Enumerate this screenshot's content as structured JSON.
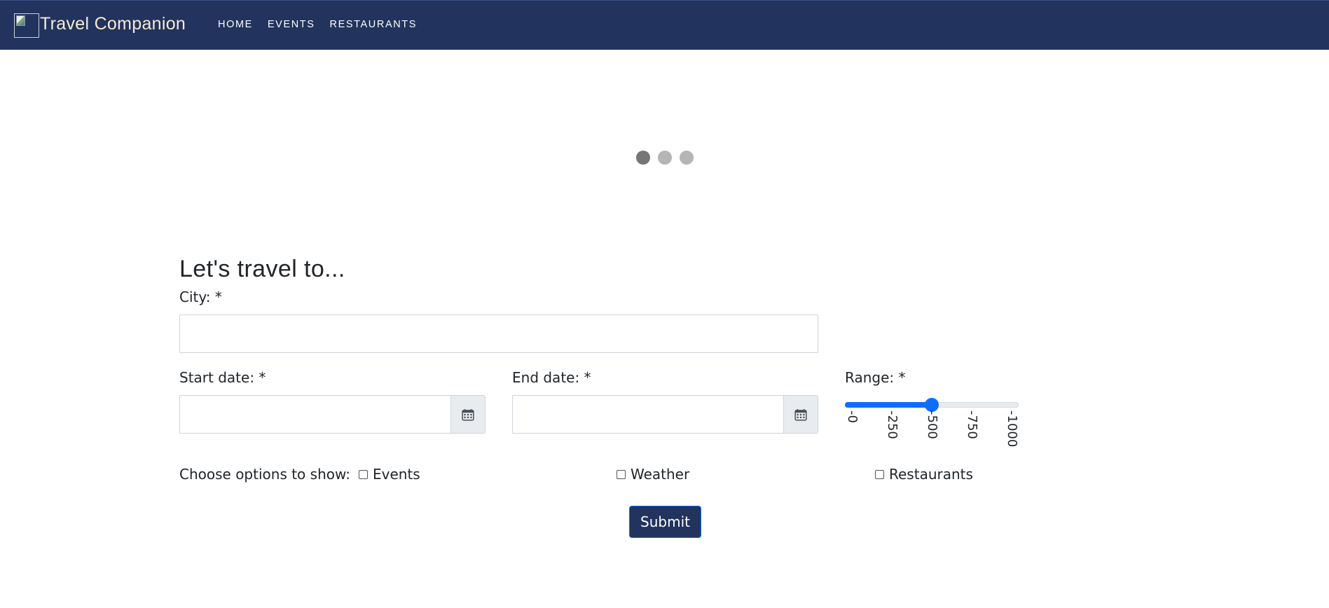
{
  "navbar": {
    "brand": "Travel Companion",
    "links": [
      "HOME",
      "EVENTS",
      "RESTAURANTS"
    ]
  },
  "carousel": {
    "indicator_count": 3,
    "active_index": 0
  },
  "form": {
    "heading": "Let's travel to...",
    "city_label": "City: *",
    "city_value": "",
    "start_date_label": "Start date: *",
    "start_date_value": "",
    "end_date_label": "End date: *",
    "end_date_value": "",
    "range_label": "Range: *",
    "range": {
      "min": 0,
      "max": 1000,
      "value": 500,
      "ticks": [
        "0",
        "250",
        "500",
        "750",
        "1000"
      ]
    },
    "options_label": "Choose options to show:",
    "options": [
      {
        "label": "Events",
        "checked": false
      },
      {
        "label": "Weather",
        "checked": false
      },
      {
        "label": "Restaurants",
        "checked": false
      }
    ],
    "submit_label": "Submit"
  },
  "colors": {
    "navbar_bg": "#22335d",
    "brand_text": "#f7ead7",
    "accent": "#0d6efd"
  },
  "icons": {
    "calendar": "calendar-icon",
    "brand": "broken-image-icon"
  }
}
